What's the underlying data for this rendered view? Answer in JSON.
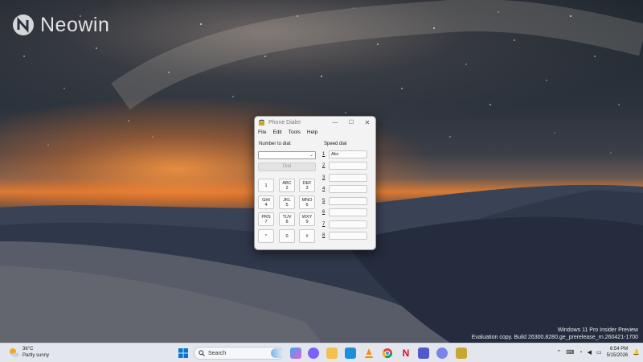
{
  "desktop": {
    "logo_text": "Neowin",
    "watermark_line1": "Windows 11 Pro Insider Preview",
    "watermark_line2": "Evaluation copy. Build 26300.8280.ge_prerelease_rn.260421-1700"
  },
  "window": {
    "title": "Phone Dialer",
    "controls": {
      "minimize": "—",
      "maximize": "☐",
      "close": "✕"
    },
    "menu": [
      "File",
      "Edit",
      "Tools",
      "Help"
    ],
    "number_label": "Number to dial:",
    "number_value": "",
    "dial_label": "Dial",
    "keypad": [
      {
        "letters": "",
        "digit": "1"
      },
      {
        "letters": "ABC",
        "digit": "2"
      },
      {
        "letters": "DEF",
        "digit": "3"
      },
      {
        "letters": "GHI",
        "digit": "4"
      },
      {
        "letters": "JKL",
        "digit": "5"
      },
      {
        "letters": "MNO",
        "digit": "6"
      },
      {
        "letters": "PRS",
        "digit": "7"
      },
      {
        "letters": "TUV",
        "digit": "8"
      },
      {
        "letters": "WXY",
        "digit": "9"
      },
      {
        "letters": "",
        "digit": "*"
      },
      {
        "letters": "",
        "digit": "0"
      },
      {
        "letters": "",
        "digit": "#"
      }
    ],
    "speed_dial_label": "Speed dial",
    "speed_dial": [
      {
        "num": "1",
        "name": "Abc"
      },
      {
        "num": "2",
        "name": ""
      },
      {
        "num": "3",
        "name": ""
      },
      {
        "num": "4",
        "name": ""
      },
      {
        "num": "5",
        "name": ""
      },
      {
        "num": "6",
        "name": ""
      },
      {
        "num": "7",
        "name": ""
      },
      {
        "num": "8",
        "name": ""
      }
    ]
  },
  "taskbar": {
    "weather_temp": "36°C",
    "weather_desc": "Partly sunny",
    "search_placeholder": "Search",
    "time": "6:54 PM",
    "date": "5/15/2026"
  },
  "colors": {
    "taskbar_bg": "#e4e6ee",
    "window_bg": "#f3f3f3",
    "accent": "#0067c0"
  }
}
